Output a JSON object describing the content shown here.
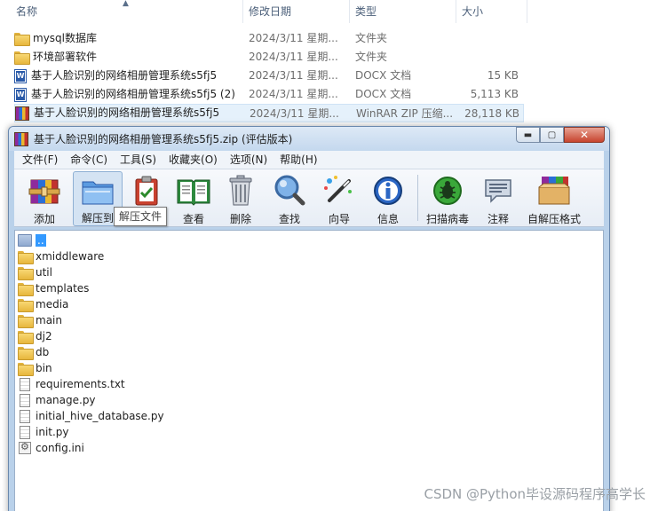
{
  "explorer": {
    "columns": {
      "name": "名称",
      "date": "修改日期",
      "type": "类型",
      "size": "大小"
    },
    "rows": [
      {
        "name": "mysql数据库",
        "date": "2024/3/11 星期...",
        "type": "文件夹",
        "size": "",
        "icon": "folder-icon"
      },
      {
        "name": "环境部署软件",
        "date": "2024/3/11 星期...",
        "type": "文件夹",
        "size": "",
        "icon": "folder-icon"
      },
      {
        "name": "基于人脸识别的网络相册管理系统s5fj5",
        "date": "2024/3/11 星期...",
        "type": "DOCX 文档",
        "size": "15 KB",
        "icon": "docx-icon"
      },
      {
        "name": "基于人脸识别的网络相册管理系统s5fj5 (2)",
        "date": "2024/3/11 星期...",
        "type": "DOCX 文档",
        "size": "5,113 KB",
        "icon": "docx-icon"
      },
      {
        "name": "基于人脸识别的网络相册管理系统s5fj5",
        "date": "2024/3/11 星期...",
        "type": "WinRAR ZIP 压缩...",
        "size": "28,118 KB",
        "icon": "winrar-archive-icon"
      }
    ]
  },
  "winrar": {
    "title": "基于人脸识别的网络相册管理系统s5fj5.zip (评估版本)",
    "window_buttons": {
      "minimize": "▬",
      "maximize": "▢",
      "close": "✕"
    },
    "menu": [
      "文件(F)",
      "命令(C)",
      "工具(S)",
      "收藏夹(O)",
      "选项(N)",
      "帮助(H)"
    ],
    "toolbar": [
      {
        "label": "添加",
        "icon": "add-archive-icon"
      },
      {
        "label": "解压到",
        "icon": "extract-folder-icon"
      },
      {
        "label": "测试",
        "icon": "test-clipboard-icon"
      },
      {
        "label": "查看",
        "icon": "view-book-icon"
      },
      {
        "label": "删除",
        "icon": "trash-icon"
      },
      {
        "label": "查找",
        "icon": "magnifier-icon"
      },
      {
        "label": "向导",
        "icon": "wizard-wand-icon"
      },
      {
        "label": "信息",
        "icon": "info-icon"
      },
      {
        "label": "扫描病毒",
        "icon": "virus-scan-icon"
      },
      {
        "label": "注释",
        "icon": "comment-icon"
      },
      {
        "label": "自解压格式",
        "icon": "sfx-box-icon"
      }
    ],
    "tooltip": "解压文件",
    "files": [
      {
        "name": "..",
        "icon": "up-folder-icon"
      },
      {
        "name": "xmiddleware",
        "icon": "folder-icon"
      },
      {
        "name": "util",
        "icon": "folder-icon"
      },
      {
        "name": "templates",
        "icon": "folder-icon"
      },
      {
        "name": "media",
        "icon": "folder-icon"
      },
      {
        "name": "main",
        "icon": "folder-icon"
      },
      {
        "name": "dj2",
        "icon": "folder-icon"
      },
      {
        "name": "db",
        "icon": "folder-icon"
      },
      {
        "name": "bin",
        "icon": "folder-icon"
      },
      {
        "name": "requirements.txt",
        "icon": "text-file-icon"
      },
      {
        "name": "manage.py",
        "icon": "text-file-icon"
      },
      {
        "name": "initial_hive_database.py",
        "icon": "text-file-icon"
      },
      {
        "name": "init.py",
        "icon": "text-file-icon"
      },
      {
        "name": "config.ini",
        "icon": "config-file-icon"
      }
    ]
  },
  "watermark": "CSDN @Python毕设源码程序高学长"
}
